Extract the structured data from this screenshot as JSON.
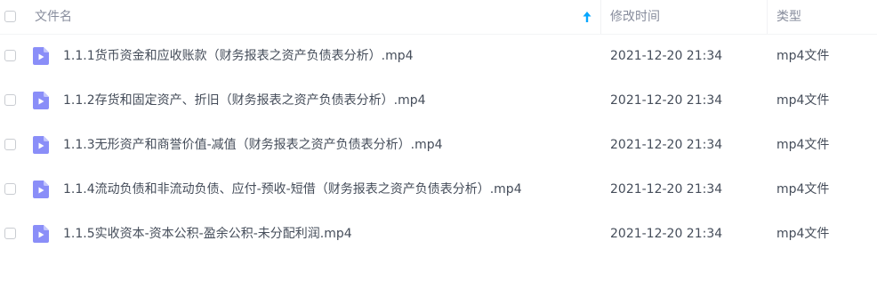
{
  "header": {
    "name_label": "文件名",
    "time_label": "修改时间",
    "type_label": "类型",
    "sort_direction": "ascending"
  },
  "colors": {
    "header_text": "#878c9c",
    "row_text": "#454d5a",
    "sort_arrow": "#06a7ff",
    "video_icon": "#8a8ef8"
  },
  "files": [
    {
      "name": "1.1.1货币资金和应收账款（财务报表之资产负债表分析）.mp4",
      "time": "2021-12-20 21:34",
      "type": "mp4文件",
      "icon": "video-file-icon"
    },
    {
      "name": "1.1.2存货和固定资产、折旧（财务报表之资产负债表分析）.mp4",
      "time": "2021-12-20 21:34",
      "type": "mp4文件",
      "icon": "video-file-icon"
    },
    {
      "name": "1.1.3无形资产和商誉价值-减值（财务报表之资产负债表分析）.mp4",
      "time": "2021-12-20 21:34",
      "type": "mp4文件",
      "icon": "video-file-icon"
    },
    {
      "name": "1.1.4流动负债和非流动负债、应付-预收-短借（财务报表之资产负债表分析）.mp4",
      "time": "2021-12-20 21:34",
      "type": "mp4文件",
      "icon": "video-file-icon"
    },
    {
      "name": "1.1.5实收资本-资本公积-盈余公积-未分配利润.mp4",
      "time": "2021-12-20 21:34",
      "type": "mp4文件",
      "icon": "video-file-icon"
    }
  ]
}
